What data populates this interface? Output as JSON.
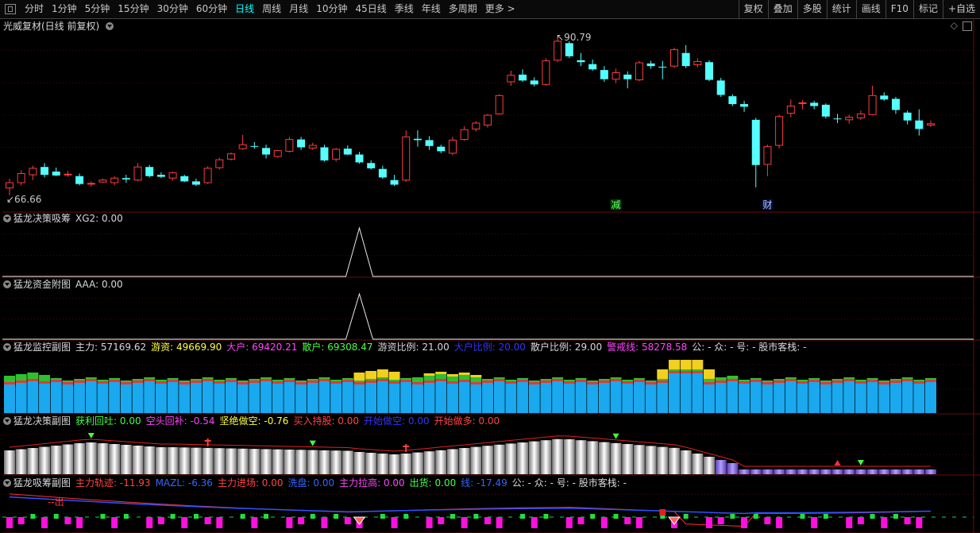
{
  "toolbar": {
    "periods": [
      "分时",
      "1分钟",
      "5分钟",
      "15分钟",
      "30分钟",
      "60分钟",
      "日线",
      "周线",
      "月线",
      "10分钟",
      "45日线",
      "季线",
      "年线",
      "多周期",
      "更多 >"
    ],
    "active": "日线",
    "right": [
      "复权",
      "叠加",
      "多股",
      "统计",
      "画线",
      "F10",
      "标记",
      "+自选"
    ]
  },
  "main": {
    "title": "光威复材(日线 前复权)",
    "high_label": "90.79",
    "low_label": "66.66",
    "events": [
      "减",
      "财"
    ]
  },
  "p1": {
    "title": "猛龙决策吸筹",
    "items": [
      {
        "t": "XG2: 0.00",
        "c": "#d8d8d8"
      }
    ]
  },
  "p2": {
    "title": "猛龙资金附图",
    "items": [
      {
        "t": "AAA: 0.00",
        "c": "#d8d8d8"
      }
    ]
  },
  "p3": {
    "title": "猛龙监控副图",
    "items": [
      {
        "t": "主力: 57169.62",
        "c": "#d8d8d8"
      },
      {
        "t": "游资: 49669.90",
        "c": "#ffff44"
      },
      {
        "t": "大户: 69420.21",
        "c": "#ff44ff"
      },
      {
        "t": "散户: 69308.47",
        "c": "#44ff44"
      },
      {
        "t": "游资比例: 21.00",
        "c": "#d8d8d8"
      },
      {
        "t": "大户比例: 20.00",
        "c": "#3333ff"
      },
      {
        "t": "散户比例: 29.00",
        "c": "#d8d8d8"
      },
      {
        "t": "警戒线: 58278.58",
        "c": "#ff44ff"
      },
      {
        "t": "公: -  众: -  号: -  股市客栈: -",
        "c": "#d8d8d8"
      }
    ]
  },
  "p4": {
    "title": "猛龙决策副图",
    "items": [
      {
        "t": "获利回吐: 0.00",
        "c": "#44ff44"
      },
      {
        "t": "空头回补: -0.54",
        "c": "#ff44ff"
      },
      {
        "t": "坚绝做空: -0.76",
        "c": "#ffff44"
      },
      {
        "t": "买入持股: 0.00",
        "c": "#ff4444"
      },
      {
        "t": "开始做空: 0.00",
        "c": "#3333ff"
      },
      {
        "t": "开始做多: 0.00",
        "c": "#ff4444"
      }
    ]
  },
  "p5": {
    "title": "猛龙吸筹副图",
    "items": [
      {
        "t": "主力轨迹: -11.93",
        "c": "#ff4444"
      },
      {
        "t": "MAZL: -6.36",
        "c": "#3366ff"
      },
      {
        "t": "主力进场: 0.00",
        "c": "#ff4444"
      },
      {
        "t": "洗盘: 0.00",
        "c": "#3366ff"
      },
      {
        "t": "主力拉高: 0.00",
        "c": "#ff44ff"
      },
      {
        "t": "出货: 0.00",
        "c": "#44ff44"
      },
      {
        "t": "线: -17.49",
        "c": "#3366ff"
      },
      {
        "t": "公: -  众: -  号: -  股市客栈: -",
        "c": "#d8d8d8"
      }
    ],
    "note": "--出"
  },
  "chart_data": {
    "type": "candlestick",
    "high": 90.79,
    "low": 66.66,
    "ohlc": [
      [
        67.8,
        69.2,
        66.66,
        68.6
      ],
      [
        68.6,
        70.5,
        68.2,
        70.0
      ],
      [
        69.8,
        71.2,
        69.0,
        70.8
      ],
      [
        71.0,
        71.6,
        69.4,
        69.8
      ],
      [
        70.3,
        70.9,
        69.6,
        69.7
      ],
      [
        69.8,
        70.4,
        69.5,
        69.9
      ],
      [
        69.6,
        70.0,
        68.2,
        68.4
      ],
      [
        68.4,
        68.8,
        68.0,
        68.5
      ],
      [
        68.7,
        69.2,
        68.6,
        69.0
      ],
      [
        68.6,
        69.6,
        68.2,
        69.3
      ],
      [
        69.3,
        69.8,
        68.6,
        69.1
      ],
      [
        69.0,
        71.6,
        68.8,
        71.0
      ],
      [
        71.0,
        71.3,
        69.4,
        69.6
      ],
      [
        69.8,
        70.2,
        69.3,
        69.5
      ],
      [
        69.3,
        70.3,
        68.9,
        70.1
      ],
      [
        69.6,
        69.8,
        68.7,
        68.8
      ],
      [
        68.8,
        69.2,
        68.1,
        68.3
      ],
      [
        68.6,
        71.1,
        68.4,
        70.8
      ],
      [
        70.9,
        72.4,
        70.6,
        72.1
      ],
      [
        72.2,
        73.2,
        72.0,
        73.0
      ],
      [
        73.8,
        75.9,
        73.6,
        74.4
      ],
      [
        74.2,
        74.8,
        73.8,
        74.1
      ],
      [
        73.9,
        74.4,
        72.3,
        72.9
      ],
      [
        72.6,
        73.6,
        72.4,
        73.5
      ],
      [
        73.4,
        75.6,
        73.2,
        75.2
      ],
      [
        75.2,
        75.6,
        73.6,
        74.0
      ],
      [
        73.9,
        74.7,
        73.6,
        74.3
      ],
      [
        74.0,
        74.4,
        71.8,
        72.0
      ],
      [
        72.2,
        73.9,
        71.8,
        73.7
      ],
      [
        73.8,
        74.3,
        72.8,
        72.9
      ],
      [
        72.9,
        73.3,
        71.5,
        71.7
      ],
      [
        71.6,
        72.0,
        70.6,
        70.8
      ],
      [
        70.7,
        71.2,
        69.2,
        69.4
      ],
      [
        69.0,
        69.8,
        68.1,
        68.3
      ],
      [
        69.0,
        76.6,
        68.7,
        75.6
      ],
      [
        75.3,
        76.6,
        74.1,
        75.1
      ],
      [
        75.1,
        75.7,
        73.6,
        74.2
      ],
      [
        74.1,
        74.4,
        73.1,
        73.4
      ],
      [
        73.1,
        75.6,
        72.8,
        75.1
      ],
      [
        75.2,
        77.2,
        75.0,
        76.7
      ],
      [
        76.8,
        78.0,
        76.4,
        77.7
      ],
      [
        77.4,
        79.1,
        77.0,
        78.9
      ],
      [
        79.1,
        82.1,
        79.0,
        81.9
      ],
      [
        84.0,
        85.7,
        83.4,
        85.0
      ],
      [
        85.1,
        85.9,
        84.0,
        84.2
      ],
      [
        84.2,
        84.7,
        83.3,
        83.6
      ],
      [
        83.6,
        87.6,
        83.4,
        87.2
      ],
      [
        87.3,
        90.79,
        87.0,
        90.2
      ],
      [
        89.9,
        90.2,
        87.6,
        87.9
      ],
      [
        87.3,
        88.4,
        86.4,
        87.0
      ],
      [
        86.7,
        87.4,
        85.7,
        85.9
      ],
      [
        85.8,
        86.4,
        84.0,
        84.4
      ],
      [
        84.4,
        86.0,
        83.8,
        85.4
      ],
      [
        85.1,
        85.6,
        83.0,
        84.4
      ],
      [
        84.3,
        87.2,
        84.1,
        86.9
      ],
      [
        86.8,
        87.2,
        86.0,
        86.4
      ],
      [
        86.3,
        87.2,
        84.4,
        86.2
      ],
      [
        86.4,
        89.2,
        86.1,
        88.9
      ],
      [
        88.4,
        89.6,
        86.1,
        86.4
      ],
      [
        86.6,
        87.6,
        86.2,
        87.1
      ],
      [
        87.0,
        87.3,
        84.1,
        84.3
      ],
      [
        84.2,
        84.6,
        81.7,
        82.0
      ],
      [
        81.8,
        82.1,
        80.3,
        80.6
      ],
      [
        80.6,
        81.1,
        79.4,
        80.2
      ],
      [
        78.2,
        78.5,
        67.9,
        71.3
      ],
      [
        71.4,
        74.4,
        69.6,
        74.1
      ],
      [
        74.3,
        79.0,
        73.8,
        78.7
      ],
      [
        79.2,
        81.3,
        78.6,
        80.3
      ],
      [
        80.7,
        81.2,
        79.8,
        80.8
      ],
      [
        80.8,
        81.1,
        79.8,
        80.3
      ],
      [
        80.5,
        80.7,
        78.4,
        78.7
      ],
      [
        78.4,
        79.1,
        77.7,
        78.3
      ],
      [
        78.2,
        79.0,
        77.6,
        78.6
      ],
      [
        78.5,
        79.6,
        78.2,
        79.1
      ],
      [
        79.0,
        83.4,
        78.9,
        81.9
      ],
      [
        81.9,
        82.4,
        81.1,
        81.3
      ],
      [
        81.4,
        81.7,
        79.1,
        79.7
      ],
      [
        79.3,
        79.6,
        77.5,
        78.1
      ],
      [
        78.1,
        79.8,
        75.8,
        76.8
      ],
      [
        77.4,
        78.1,
        77.1,
        77.6
      ]
    ],
    "events": [
      {
        "index": 52,
        "label": "减"
      },
      {
        "index": 65,
        "label": "财"
      }
    ]
  }
}
